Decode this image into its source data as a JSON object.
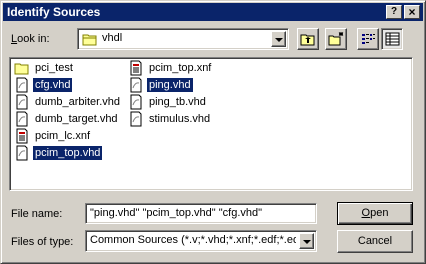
{
  "window": {
    "title": "Identify Sources",
    "help_label": "?",
    "close_label": "×"
  },
  "lookin": {
    "label": "Look in:",
    "value": "vhdl"
  },
  "files": [
    {
      "name": "pci_test",
      "type": "folder",
      "selected": false
    },
    {
      "name": "cfg.vhd",
      "type": "vhd",
      "selected": true
    },
    {
      "name": "dumb_arbiter.vhd",
      "type": "vhd",
      "selected": false
    },
    {
      "name": "dumb_target.vhd",
      "type": "vhd",
      "selected": false
    },
    {
      "name": "pcim_lc.xnf",
      "type": "xnf",
      "selected": false
    },
    {
      "name": "pcim_top.vhd",
      "type": "vhd",
      "selected": true
    },
    {
      "name": "pcim_top.xnf",
      "type": "xnf",
      "selected": false
    },
    {
      "name": "ping.vhd",
      "type": "vhd",
      "selected": true
    },
    {
      "name": "ping_tb.vhd",
      "type": "vhd",
      "selected": false
    },
    {
      "name": "stimulus.vhd",
      "type": "vhd",
      "selected": false
    }
  ],
  "filename": {
    "label": "File name:",
    "value": "\"ping.vhd\" \"pcim_top.vhd\" \"cfg.vhd\""
  },
  "filetype": {
    "label": "Files of type:",
    "value": "Common Sources (*.v;*.vhd;*.xnf;*.edf;*.edn;"
  },
  "buttons": {
    "open": "Open",
    "cancel": "Cancel"
  },
  "colors": {
    "titlebar": "#0a246a",
    "face": "#d4d0c8",
    "selection": "#0a246a"
  }
}
